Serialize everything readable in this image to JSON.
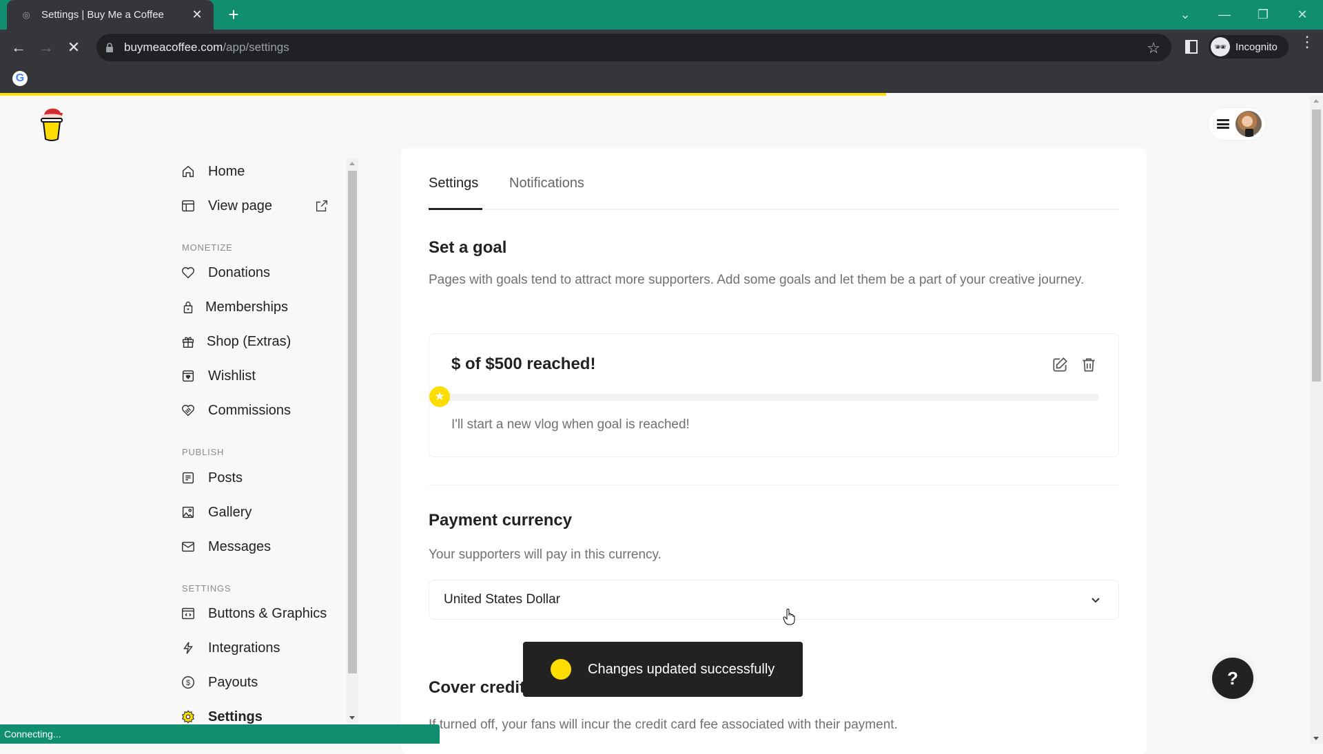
{
  "browser": {
    "tab_title": "Settings | Buy Me a Coffee",
    "new_tab_symbol": "+",
    "url_domain": "buymeacoffee.com",
    "url_path": "/app/settings",
    "profile_label": "Incognito",
    "status_text": "Connecting...",
    "loading_progress_percent": 67,
    "chrome_color": "#108e6f"
  },
  "sidebar": {
    "top_items": [
      {
        "label": "Home",
        "icon": "home-icon"
      },
      {
        "label": "View page",
        "icon": "layout-icon"
      }
    ],
    "sections": [
      {
        "label": "MONETIZE",
        "items": [
          {
            "label": "Donations",
            "icon": "heart-icon"
          },
          {
            "label": "Memberships",
            "icon": "lock-icon"
          },
          {
            "label": "Shop (Extras)",
            "icon": "gift-icon"
          },
          {
            "label": "Wishlist",
            "icon": "wishlist-icon"
          },
          {
            "label": "Commissions",
            "icon": "handshake-icon"
          }
        ]
      },
      {
        "label": "PUBLISH",
        "items": [
          {
            "label": "Posts",
            "icon": "document-icon"
          },
          {
            "label": "Gallery",
            "icon": "image-icon"
          },
          {
            "label": "Messages",
            "icon": "mail-icon"
          }
        ]
      },
      {
        "label": "SETTINGS",
        "items": [
          {
            "label": "Buttons & Graphics",
            "icon": "code-window-icon"
          },
          {
            "label": "Integrations",
            "icon": "lightning-icon"
          },
          {
            "label": "Payouts",
            "icon": "dollar-circle-icon"
          },
          {
            "label": "Settings",
            "icon": "gear-icon",
            "active": true
          }
        ]
      }
    ]
  },
  "main": {
    "tabs": [
      {
        "label": "Settings",
        "active": true
      },
      {
        "label": "Notifications",
        "active": false
      }
    ],
    "goal_section": {
      "title": "Set a goal",
      "description": "Pages with goals tend to attract more supporters. Add some goals and let them be a part of your creative journey.",
      "goal": {
        "title": "$ of $500 reached!",
        "progress_percent": 0,
        "target": "$500",
        "description": "I'll start a new vlog when goal is reached!"
      }
    },
    "currency_section": {
      "title": "Payment currency",
      "description": "Your supporters will pay in this currency.",
      "selected_currency": "United States Dollar"
    },
    "cover_fee_section": {
      "title": "Cover credit card fees",
      "description": "If turned off, your fans will incur the credit card fee associated with their payment."
    }
  },
  "toast": {
    "message": "Changes updated successfully"
  },
  "help_button": {
    "label": "?"
  },
  "colors": {
    "accent": "#ffdd00",
    "text_primary": "#222222",
    "text_secondary": "#717171"
  }
}
